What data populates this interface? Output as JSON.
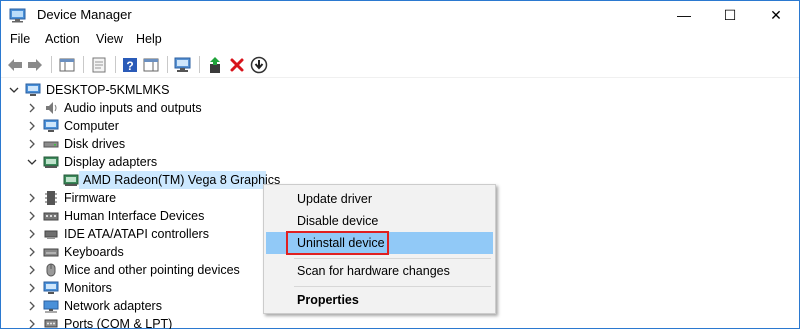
{
  "window": {
    "title": "Device Manager",
    "controls": {
      "minimize": "—",
      "maximize": "☐",
      "close": "✕"
    }
  },
  "menu": [
    "File",
    "Action",
    "View",
    "Help"
  ],
  "toolbar": {
    "buttons": [
      "back-arrow-icon",
      "forward-arrow-icon",
      "show-hide-console-tree-icon",
      "properties-icon",
      "help-icon",
      "action-pane-icon",
      "scan-hardware-icon",
      "update-driver-icon",
      "uninstall-device-icon",
      "disable-device-icon"
    ]
  },
  "tree": {
    "root": "DESKTOP-5KMLMKS",
    "items": [
      {
        "label": "Audio inputs and outputs",
        "icon": "speaker-icon",
        "expanded": false
      },
      {
        "label": "Computer",
        "icon": "computer-icon",
        "expanded": false
      },
      {
        "label": "Disk drives",
        "icon": "disk-drive-icon",
        "expanded": false
      },
      {
        "label": "Display adapters",
        "icon": "display-adapter-icon",
        "expanded": true
      },
      {
        "label": "AMD Radeon(TM) Vega 8 Graphics",
        "icon": "display-adapter-icon",
        "child": true,
        "selected": true
      },
      {
        "label": "Firmware",
        "icon": "firmware-icon",
        "expanded": false
      },
      {
        "label": "Human Interface Devices",
        "icon": "hid-icon",
        "expanded": false
      },
      {
        "label": "IDE ATA/ATAPI controllers",
        "icon": "ide-controller-icon",
        "expanded": false
      },
      {
        "label": "Keyboards",
        "icon": "keyboard-icon",
        "expanded": false
      },
      {
        "label": "Mice and other pointing devices",
        "icon": "mouse-icon",
        "expanded": false
      },
      {
        "label": "Monitors",
        "icon": "monitor-icon",
        "expanded": false
      },
      {
        "label": "Network adapters",
        "icon": "network-adapter-icon",
        "expanded": false
      },
      {
        "label": "Ports (COM & LPT)",
        "icon": "port-icon",
        "expanded": false
      }
    ]
  },
  "context_menu": {
    "items": [
      "Update driver",
      "Disable device",
      "Uninstall device",
      "Scan for hardware changes",
      "Properties"
    ],
    "highlighted": "Uninstall device",
    "default": "Properties"
  },
  "colors": {
    "window_border": "#2b79d0",
    "selection": "#cce8ff",
    "menu_hover": "#91c9f7",
    "highlight_box": "#e02020"
  }
}
